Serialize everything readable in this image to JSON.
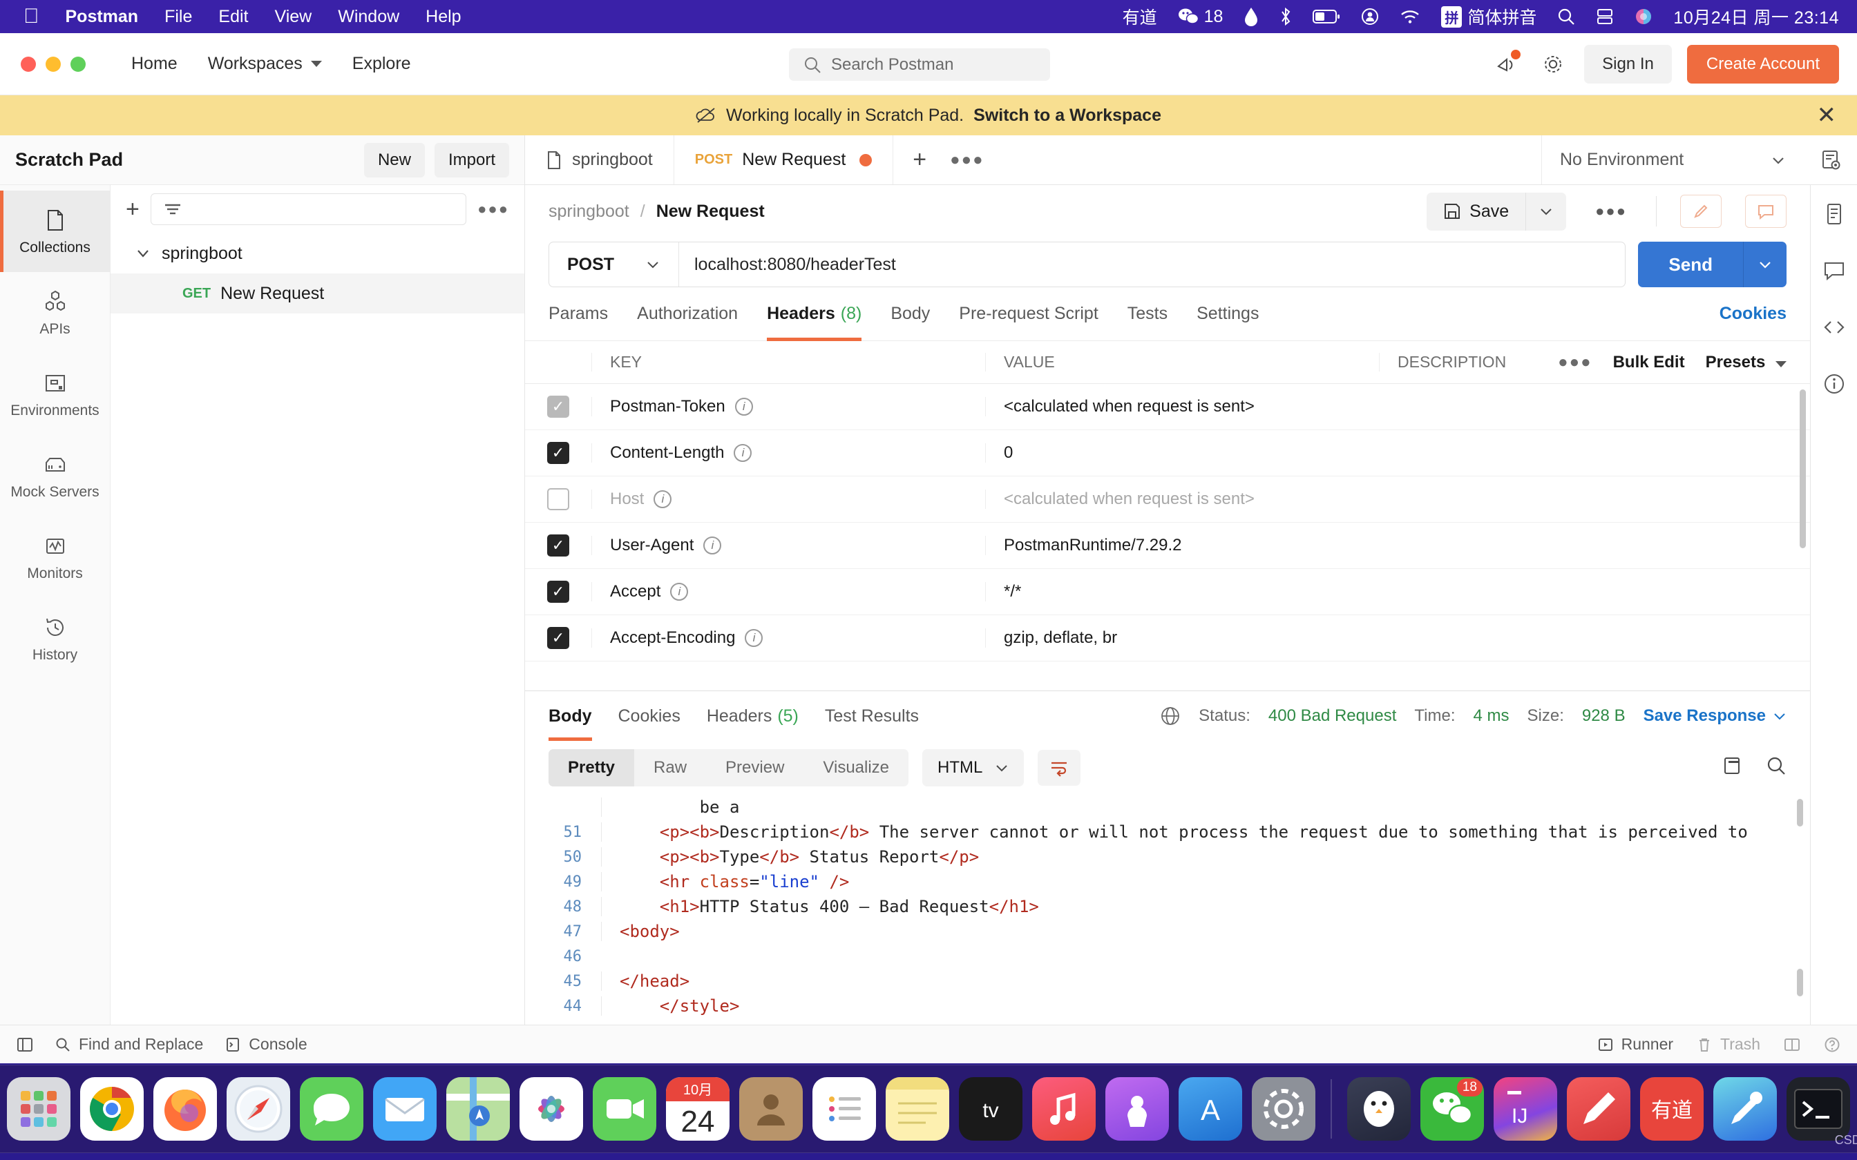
{
  "menubar": {
    "apple_icon": "apple-icon",
    "app_name": "Postman",
    "items": [
      "File",
      "Edit",
      "View",
      "Window",
      "Help"
    ],
    "right": {
      "youdao": "有道",
      "wechat_badge": "18",
      "ime_badge": "拼",
      "ime_label": "简体拼音",
      "clock": "10月24日 周一  23:14"
    }
  },
  "header": {
    "nav": [
      "Home",
      "Workspaces",
      "Explore"
    ],
    "search_placeholder": "Search Postman",
    "sign_in": "Sign In",
    "create_account": "Create Account"
  },
  "banner": {
    "text": "Working locally in Scratch Pad.",
    "link": "Switch to a Workspace",
    "close": "✕"
  },
  "sidebar": {
    "title": "Scratch Pad",
    "new_label": "New",
    "import_label": "Import",
    "rail": [
      {
        "label": "Collections",
        "icon": "collections-icon",
        "active": true
      },
      {
        "label": "APIs",
        "icon": "apis-icon",
        "active": false
      },
      {
        "label": "Environments",
        "icon": "environments-icon",
        "active": false
      },
      {
        "label": "Mock Servers",
        "icon": "mock-servers-icon",
        "active": false
      },
      {
        "label": "Monitors",
        "icon": "monitors-icon",
        "active": false
      },
      {
        "label": "History",
        "icon": "history-icon",
        "active": false
      }
    ],
    "tree": {
      "collection": "springboot",
      "request_method": "GET",
      "request_name": "New Request"
    }
  },
  "tabs": {
    "items": [
      {
        "label": "springboot",
        "method": "",
        "active": false
      },
      {
        "label": "New Request",
        "method": "POST",
        "active": true,
        "unsaved": true
      }
    ],
    "environment": "No Environment"
  },
  "request": {
    "breadcrumb_collection": "springboot",
    "breadcrumb_current": "New Request",
    "save_label": "Save",
    "method": "POST",
    "url": "localhost:8080/headerTest",
    "send_label": "Send",
    "tabs": [
      {
        "label": "Params",
        "count": "",
        "active": false
      },
      {
        "label": "Authorization",
        "count": "",
        "active": false
      },
      {
        "label": "Headers",
        "count": "(8)",
        "active": true
      },
      {
        "label": "Body",
        "count": "",
        "active": false
      },
      {
        "label": "Pre-request Script",
        "count": "",
        "active": false
      },
      {
        "label": "Tests",
        "count": "",
        "active": false
      },
      {
        "label": "Settings",
        "count": "",
        "active": false
      }
    ],
    "cookies_link": "Cookies",
    "table": {
      "columns": [
        "KEY",
        "VALUE",
        "DESCRIPTION"
      ],
      "bulk_edit": "Bulk Edit",
      "presets": "Presets",
      "rows": [
        {
          "checked": "dim",
          "key": "Postman-Token",
          "value": "<calculated when request is sent>",
          "muted": false,
          "value_muted": false
        },
        {
          "checked": "on",
          "key": "Content-Length",
          "value": "0",
          "muted": false,
          "value_muted": false
        },
        {
          "checked": "off",
          "key": "Host",
          "value": "<calculated when request is sent>",
          "muted": true,
          "value_muted": true
        },
        {
          "checked": "on",
          "key": "User-Agent",
          "value": "PostmanRuntime/7.29.2",
          "muted": false,
          "value_muted": false
        },
        {
          "checked": "on",
          "key": "Accept",
          "value": "*/*",
          "muted": false,
          "value_muted": false
        },
        {
          "checked": "on",
          "key": "Accept-Encoding",
          "value": "gzip, deflate, br",
          "muted": false,
          "value_muted": false
        }
      ]
    }
  },
  "response": {
    "tabs": [
      {
        "label": "Body",
        "count": "",
        "active": true
      },
      {
        "label": "Cookies",
        "count": "",
        "active": false
      },
      {
        "label": "Headers",
        "count": "(5)",
        "active": false
      },
      {
        "label": "Test Results",
        "count": "",
        "active": false
      }
    ],
    "status_label": "Status:",
    "status_value": "400 Bad Request",
    "time_label": "Time:",
    "time_value": "4 ms",
    "size_label": "Size:",
    "size_value": "928 B",
    "save_response": "Save Response",
    "view_modes": [
      "Pretty",
      "Raw",
      "Preview",
      "Visualize"
    ],
    "active_view": "Pretty",
    "format": "HTML",
    "code": [
      {
        "no": "44",
        "indent": 2,
        "parts": [
          {
            "t": "tg",
            "s": "</style>"
          }
        ]
      },
      {
        "no": "45",
        "indent": 0,
        "parts": [
          {
            "t": "tg",
            "s": "</head>"
          }
        ]
      },
      {
        "no": "46",
        "indent": 0,
        "parts": []
      },
      {
        "no": "47",
        "indent": 0,
        "parts": [
          {
            "t": "tg",
            "s": "<body>"
          }
        ]
      },
      {
        "no": "48",
        "indent": 2,
        "parts": [
          {
            "t": "tg",
            "s": "<h1>"
          },
          {
            "t": "p",
            "s": "HTTP Status 400 – Bad Request"
          },
          {
            "t": "tg",
            "s": "</h1>"
          }
        ]
      },
      {
        "no": "49",
        "indent": 2,
        "parts": [
          {
            "t": "tg",
            "s": "<hr "
          },
          {
            "t": "at",
            "s": "class"
          },
          {
            "t": "p",
            "s": "="
          },
          {
            "t": "st",
            "s": "\"line\""
          },
          {
            "t": "tg",
            "s": " />"
          }
        ]
      },
      {
        "no": "50",
        "indent": 2,
        "parts": [
          {
            "t": "tg",
            "s": "<p><b>"
          },
          {
            "t": "p",
            "s": "Type"
          },
          {
            "t": "tg",
            "s": "</b>"
          },
          {
            "t": "p",
            "s": " Status Report"
          },
          {
            "t": "tg",
            "s": "</p>"
          }
        ]
      },
      {
        "no": "51",
        "indent": 2,
        "parts": [
          {
            "t": "tg",
            "s": "<p><b>"
          },
          {
            "t": "p",
            "s": "Description"
          },
          {
            "t": "tg",
            "s": "</b>"
          },
          {
            "t": "p",
            "s": " The server cannot or will not process the request due to something that is perceived to"
          }
        ]
      },
      {
        "no": "",
        "indent": 4,
        "parts": [
          {
            "t": "p",
            "s": "be a"
          }
        ]
      }
    ]
  },
  "footer": {
    "find_replace": "Find and Replace",
    "console": "Console",
    "runner": "Runner",
    "trash": "Trash"
  },
  "dock": {
    "calendar_month": "10月",
    "calendar_day": "24",
    "wechat_badge": "18",
    "youdao": "有道"
  },
  "watermark": "CSDN @挽凉依",
  "colors": {
    "accent": "#ef6c3f",
    "send_blue": "#3576d3",
    "link_blue": "#1a73c8",
    "green": "#3aa655",
    "banner": "#f8df91",
    "menubar": "#3a21a8"
  }
}
